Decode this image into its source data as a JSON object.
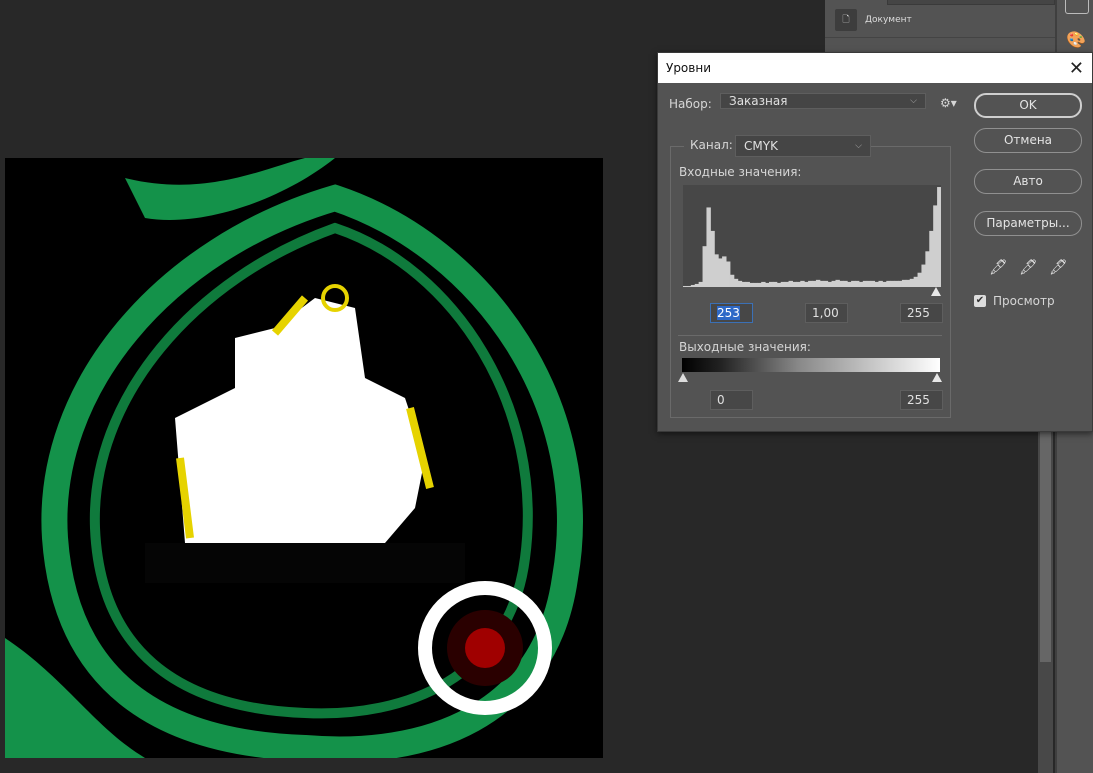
{
  "panel": {
    "document_label": "Документ"
  },
  "dialog": {
    "title": "Уровни",
    "preset_label": "Набор:",
    "preset_value": "Заказная",
    "channel_label": "Канал:",
    "channel_value": "CMYK",
    "input_label": "Входные значения:",
    "input_black": "253",
    "input_gamma": "1,00",
    "input_white": "255",
    "output_label": "Выходные значения:",
    "output_black": "0",
    "output_white": "255",
    "buttons": {
      "ok": "OK",
      "cancel": "Отмена",
      "auto": "Авто",
      "options": "Параметры..."
    },
    "preview_label": "Просмотр",
    "preview_checked": true
  },
  "histogram": [
    1,
    1,
    2,
    3,
    5,
    40,
    78,
    55,
    32,
    28,
    30,
    25,
    12,
    8,
    6,
    5,
    5,
    4,
    4,
    4,
    5,
    4,
    5,
    5,
    4,
    5,
    5,
    6,
    5,
    5,
    6,
    5,
    6,
    6,
    7,
    6,
    6,
    5,
    6,
    7,
    6,
    6,
    5,
    6,
    6,
    5,
    6,
    6,
    6,
    5,
    6,
    5,
    6,
    6,
    6,
    6,
    7,
    7,
    8,
    10,
    14,
    22,
    35,
    55,
    80,
    98
  ]
}
